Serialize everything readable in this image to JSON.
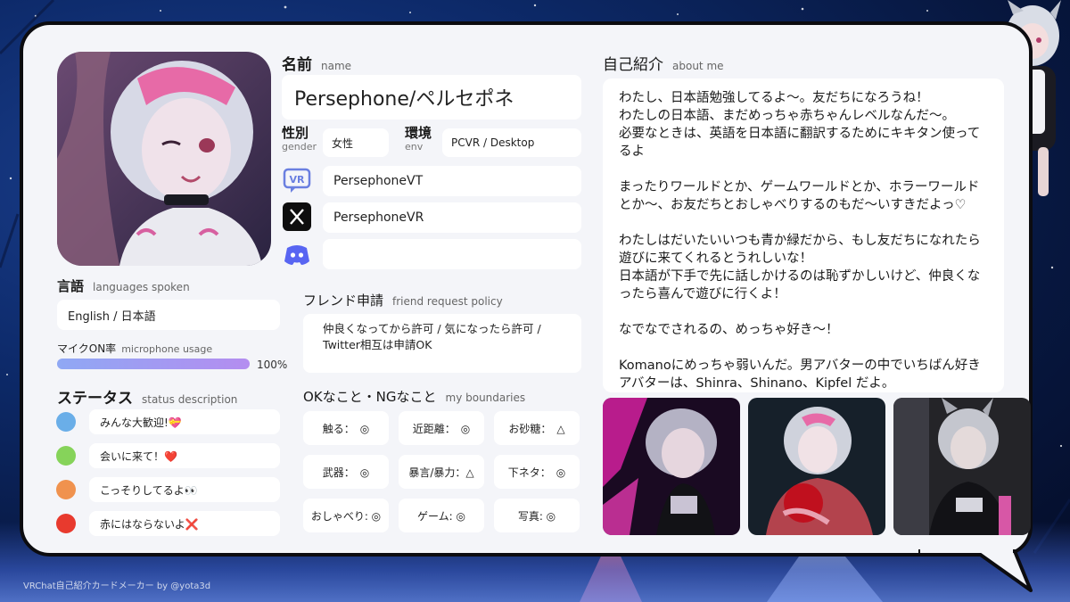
{
  "name": {
    "label": "名前",
    "sub": "name",
    "value": "Persephone/ペルセポネ"
  },
  "gender": {
    "label": "性別",
    "sub": "gender",
    "value": "女性"
  },
  "env": {
    "label": "環境",
    "sub": "env",
    "value": "PCVR / Desktop"
  },
  "accounts": [
    {
      "icon": "vrchat-icon",
      "value": "PersephoneVT"
    },
    {
      "icon": "x-icon",
      "value": "PersephoneVR"
    },
    {
      "icon": "discord-icon",
      "value": ""
    }
  ],
  "languages": {
    "label": "言語",
    "sub": "languages spoken",
    "value": "English / 日本語"
  },
  "mic": {
    "label": "マイクON率",
    "sub": "microphone usage",
    "value": "100%",
    "fraction": 1.0
  },
  "status": {
    "label": "ステータス",
    "sub": "status description",
    "items": [
      {
        "color": "#6aaee8",
        "text": "みんな大歓迎!💝"
      },
      {
        "color": "#86d35a",
        "text": "会いに来て！❤️"
      },
      {
        "color": "#f0924e",
        "text": "こっそりしてるよ👀"
      },
      {
        "color": "#e83a2e",
        "text": "赤にはならないよ❌"
      }
    ]
  },
  "friend": {
    "label": "フレンド申請",
    "sub": "friend request policy",
    "value": "仲良くなってから許可 / 気になったら許可 / Twitter相互は申請OK"
  },
  "boundaries": {
    "label": "OKなこと・NGなこと",
    "sub": "my boundaries",
    "items": [
      "触る：　◎",
      "近距離：　◎",
      "お砂糖：　△",
      "武器：　◎",
      "暴言/暴力：△",
      "下ネタ：　◎",
      "おしゃべり: ◎",
      "ゲーム: ◎",
      "写真: ◎"
    ]
  },
  "about": {
    "label": "自己紹介",
    "sub": "about me",
    "paragraphs": [
      "わたし、日本語勉強してるよ〜。友だちになろうね！\nわたしの日本語、まだめっちゃ赤ちゃんレベルなんだ〜。\n必要なときは、英語を日本語に翻訳するためにキキタン使ってるよ",
      "まったりワールドとか、ゲームワールドとか、ホラーワールドとか〜、お友だちとおしゃべりするのもだ〜いすきだよっ♡",
      "わたしはだいたいいつも青か緑だから、もし友だちになれたら遊びに来てくれるとうれしいな！\n日本語が下手で先に話しかけるのは恥ずかしいけど、仲良くなったら喜んで遊びに行くよ！",
      "なでなでされるの、めっちゃ好き〜！",
      " Komanoにめっちゃ弱いんだ。男アバターの中でいちばん好きアバターは、Shinra、Shinano、Kipfel だよ。"
    ]
  },
  "footer": "VRChat自己紹介カードメーカー by @yota3d",
  "colors": {
    "card": "#f4f5f9",
    "accent_bar": "#8fa8f4",
    "bar_end": "#b48df0",
    "vrchat": "#6a7fe0",
    "discord": "#5865f2"
  }
}
